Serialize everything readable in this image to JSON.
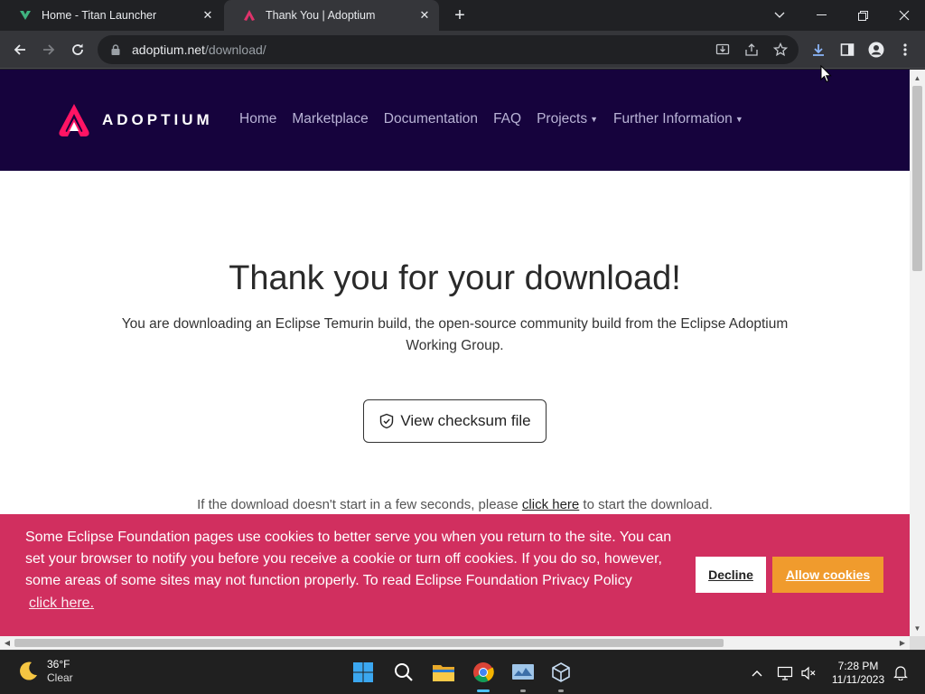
{
  "browser": {
    "tabs": [
      {
        "title": "Home - Titan Launcher",
        "active": false,
        "favicon": "titan-logo-icon"
      },
      {
        "title": "Thank You | Adoptium",
        "active": true,
        "favicon": "adoptium-logo-icon"
      }
    ],
    "url_host": "adoptium.net",
    "url_path": "/download/"
  },
  "site": {
    "logo_text": "ADOPTIUM",
    "nav": [
      {
        "label": "Home",
        "dropdown": false
      },
      {
        "label": "Marketplace",
        "dropdown": false
      },
      {
        "label": "Documentation",
        "dropdown": false
      },
      {
        "label": "FAQ",
        "dropdown": false
      },
      {
        "label": "Projects",
        "dropdown": true
      },
      {
        "label": "Further Information",
        "dropdown": true
      }
    ],
    "colors": {
      "header_bg": "#16033d",
      "cookie_bg": "#d12f5f",
      "allow_bg": "#f09b2d"
    }
  },
  "main": {
    "heading": "Thank you for your download!",
    "subtext": "You are downloading an Eclipse Temurin build, the open-source community build from the Eclipse Adoptium Working Group.",
    "checksum_button": "View checksum file",
    "retry_prefix": "If the download doesn't start in a few seconds, please ",
    "retry_link": "click here",
    "retry_suffix": " to start the download."
  },
  "cookie_banner": {
    "text": "Some Eclipse Foundation pages use cookies to better serve you when you return to the site. You can set your browser to notify you before you receive a cookie or turn off cookies. If you do so, however, some areas of some sites may not function properly. To read Eclipse Foundation Privacy Policy",
    "link": "click here.",
    "decline": "Decline",
    "allow": "Allow cookies"
  },
  "taskbar": {
    "weather_temp": "36°F",
    "weather_cond": "Clear",
    "time": "7:28 PM",
    "date": "11/11/2023"
  }
}
